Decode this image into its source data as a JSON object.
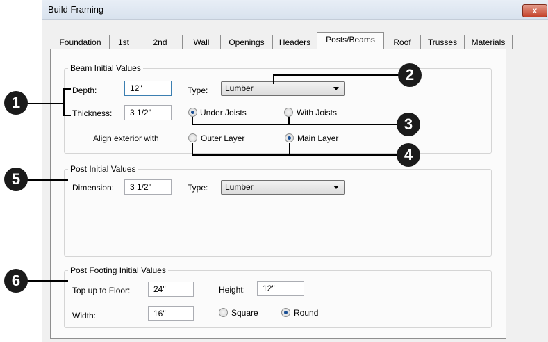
{
  "window": {
    "title": "Build Framing",
    "close_label": "x"
  },
  "tabs": [
    {
      "label": "Foundation"
    },
    {
      "label": "1st"
    },
    {
      "label": "2nd"
    },
    {
      "label": "Wall"
    },
    {
      "label": "Openings"
    },
    {
      "label": "Headers"
    },
    {
      "label": "Posts/Beams",
      "active": true
    },
    {
      "label": "Roof"
    },
    {
      "label": "Trusses"
    },
    {
      "label": "Materials"
    }
  ],
  "beam": {
    "group_label": "Beam Initial Values",
    "depth_label": "Depth:",
    "depth_value": "12\"",
    "thickness_label": "Thickness:",
    "thickness_value": "3 1/2\"",
    "type_label": "Type:",
    "type_value": "Lumber",
    "under_joists_label": "Under Joists",
    "with_joists_label": "With Joists",
    "align_label": "Align exterior with",
    "outer_layer_label": "Outer Layer",
    "main_layer_label": "Main Layer"
  },
  "post": {
    "group_label": "Post Initial Values",
    "dimension_label": "Dimension:",
    "dimension_value": "3 1/2\"",
    "type_label": "Type:",
    "type_value": "Lumber"
  },
  "footing": {
    "group_label": "Post Footing Initial Values",
    "top_label": "Top up to Floor:",
    "top_value": "24\"",
    "height_label": "Height:",
    "height_value": "12\"",
    "width_label": "Width:",
    "width_value": "16\"",
    "square_label": "Square",
    "round_label": "Round"
  },
  "callouts": [
    "1",
    "2",
    "3",
    "4",
    "5",
    "6"
  ]
}
